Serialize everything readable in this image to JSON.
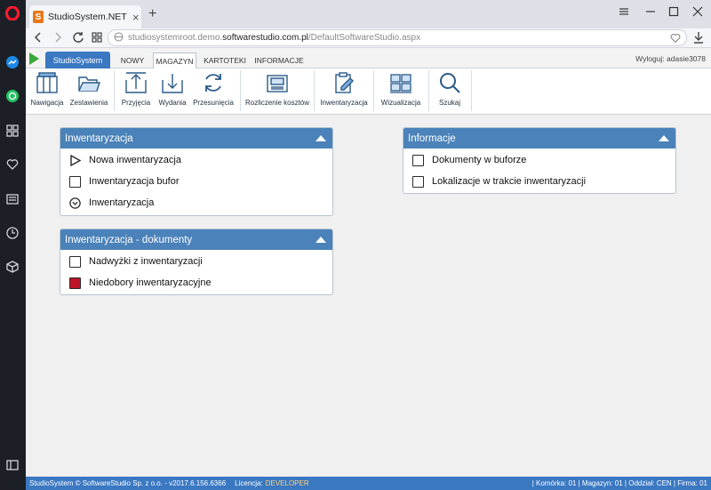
{
  "browser": {
    "tab_title": "StudioSystem.NET (c) Soft",
    "favicon_letter": "S",
    "url_prefix": "studiosystemroot.demo.",
    "url_domain": "softwarestudio.com.pl",
    "url_path": "/DefaultSoftwareStudio.aspx"
  },
  "app": {
    "title_button": "StudioSystem",
    "menu_tabs": [
      "NOWY",
      "MAGAZYN",
      "KARTOTEKI",
      "INFORMACJE"
    ],
    "active_tab": "MAGAZYN",
    "logout": "Wyloguj: adasie3078"
  },
  "ribbon": {
    "buttons": [
      {
        "label": "Nawigacja",
        "icon": "cabinet-icon"
      },
      {
        "label": "Zestawienia",
        "icon": "folder-icon"
      },
      {
        "label": "Przyjęcia",
        "icon": "inbox-arrow-up-icon"
      },
      {
        "label": "Wydania",
        "icon": "inbox-arrow-down-icon"
      },
      {
        "label": "Przesunięcia",
        "icon": "refresh-icon"
      },
      {
        "label": "Rozliczenie kosztów",
        "icon": "cash-register-icon"
      },
      {
        "label": "Inwentaryzacja",
        "icon": "clipboard-edit-icon"
      },
      {
        "label": "Wizualizacja",
        "icon": "pallets-icon"
      },
      {
        "label": "Szukaj",
        "icon": "search-icon"
      }
    ]
  },
  "panels": {
    "inwentaryzacja": {
      "title": "Inwentaryzacja",
      "items": [
        "Nowa inwentaryzacja",
        "Inwentaryzacja bufor",
        "Inwentaryzacja"
      ]
    },
    "dokumenty": {
      "title": "Inwentaryzacja - dokumenty",
      "items": [
        "Nadwyżki z inwentaryzacji",
        "Niedobory inwentaryzacyjne"
      ]
    },
    "informacje": {
      "title": "Informacje",
      "items": [
        "Dokumenty w buforze",
        "Lokalizacje w trakcie inwentaryzacji"
      ]
    }
  },
  "status": {
    "copyright": "StudioSystem © SoftwareStudio Sp. z o.o. - v2017.6.156.6366",
    "license_label": "Licencja:",
    "license_value": "DEVELOPER",
    "right": "| Komórka: 01 | Magazyn: 01 | Oddział: CEN | Firma: 01"
  },
  "colors": {
    "accent": "#3a78c2",
    "panel_header": "#4a82b9",
    "red_marker": "#c0142a"
  }
}
